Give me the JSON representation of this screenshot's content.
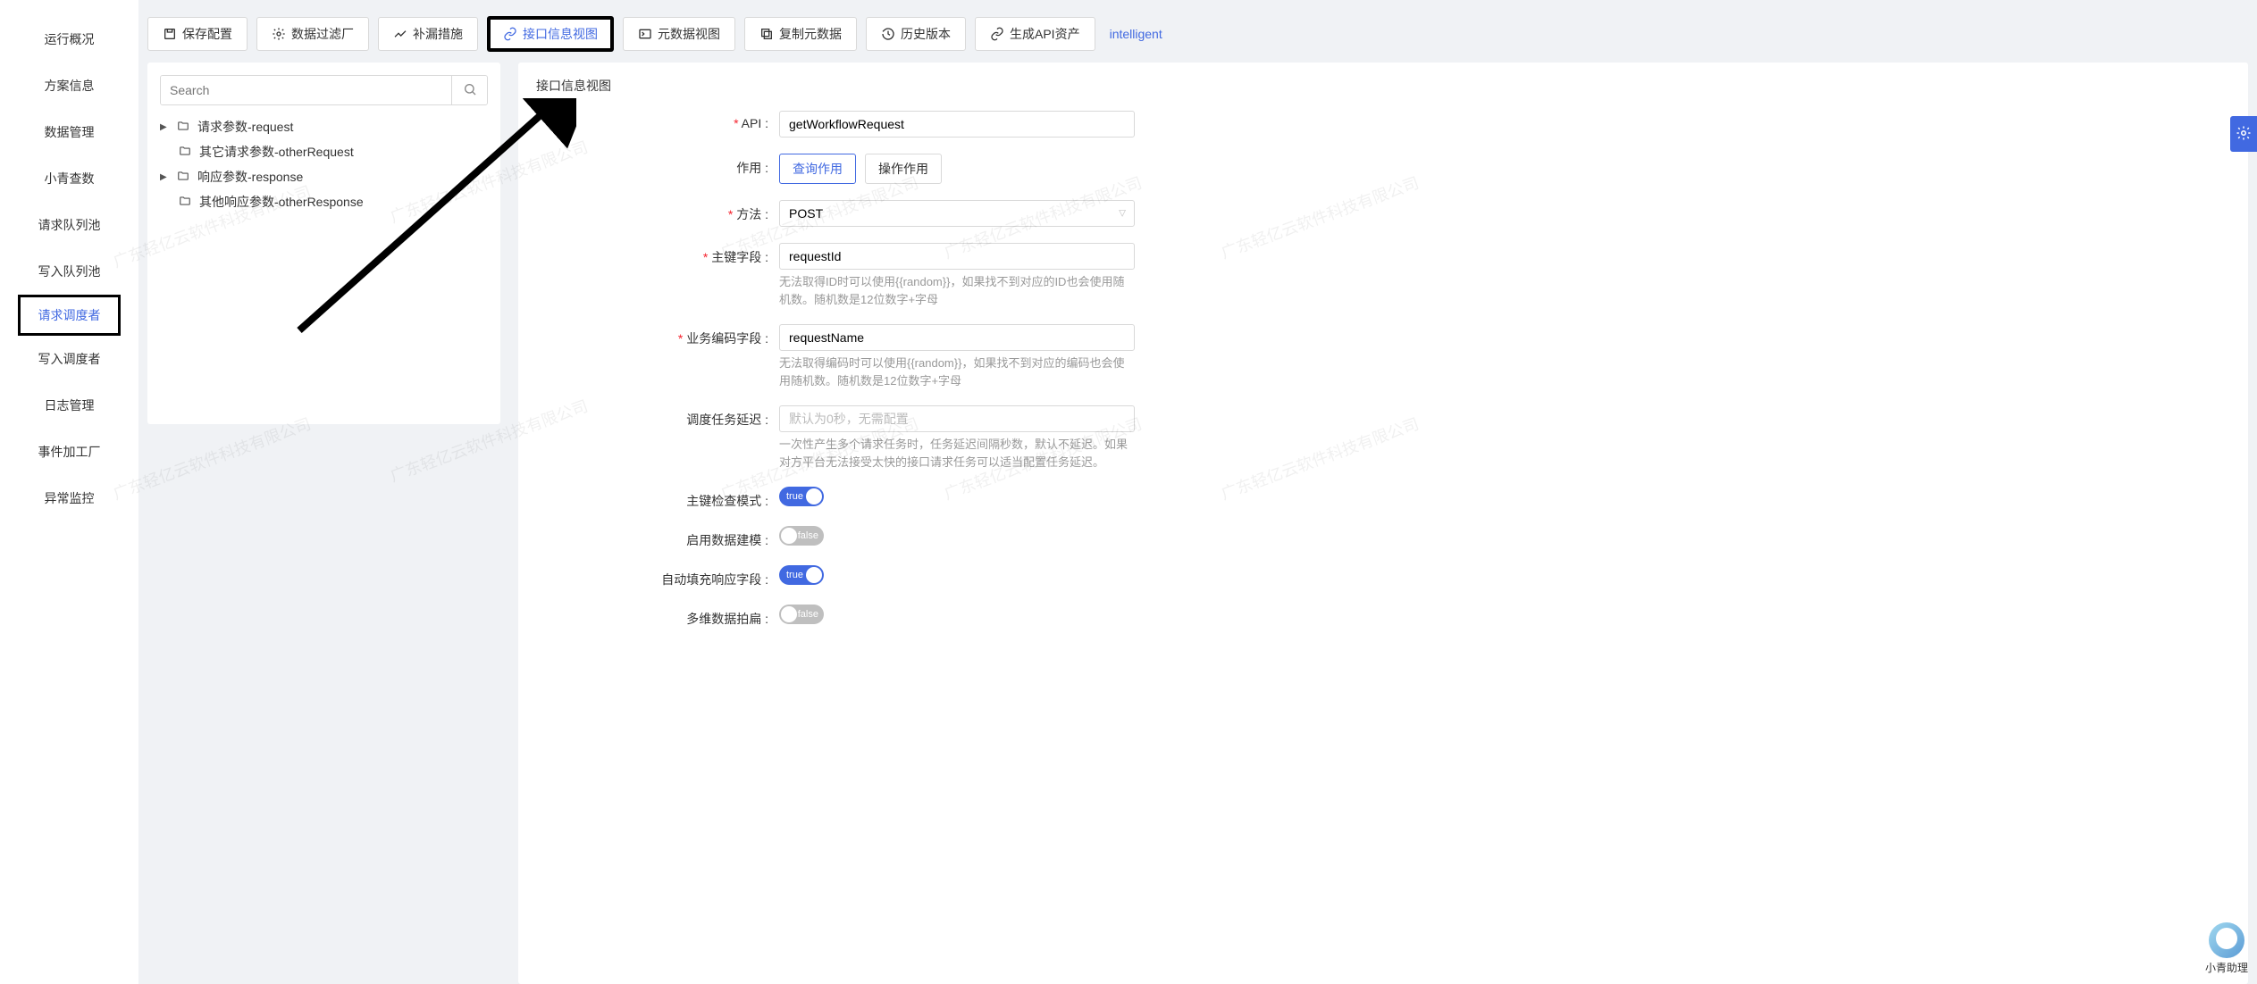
{
  "sidebar": {
    "items": [
      {
        "label": "运行概况"
      },
      {
        "label": "方案信息"
      },
      {
        "label": "数据管理"
      },
      {
        "label": "小青查数"
      },
      {
        "label": "请求队列池"
      },
      {
        "label": "写入队列池"
      },
      {
        "label": "请求调度者"
      },
      {
        "label": "写入调度者"
      },
      {
        "label": "日志管理"
      },
      {
        "label": "事件加工厂"
      },
      {
        "label": "异常监控"
      }
    ],
    "active_index": 6
  },
  "toolbar": {
    "save": "保存配置",
    "filter": "数据过滤厂",
    "patch": "补漏措施",
    "api_view": "接口信息视图",
    "metadata": "元数据视图",
    "copy_meta": "复制元数据",
    "history": "历史版本",
    "gen_api": "生成API资产",
    "intelligent": "intelligent"
  },
  "tree": {
    "search_placeholder": "Search",
    "items": [
      {
        "label": "请求参数-request",
        "expand": true
      },
      {
        "label": "其它请求参数-otherRequest",
        "expand": false
      },
      {
        "label": "响应参数-response",
        "expand": true
      },
      {
        "label": "其他响应参数-otherResponse",
        "expand": false
      }
    ]
  },
  "panel": {
    "title": "接口信息视图",
    "api_label": "API :",
    "api_value": "getWorkflowRequest",
    "role_label": "作用 :",
    "role_options": [
      "查询作用",
      "操作作用"
    ],
    "role_selected": 0,
    "method_label": "方法 :",
    "method_value": "POST",
    "pk_label": "主键字段 :",
    "pk_value": "requestId",
    "pk_help": "无法取得ID时可以使用{{random}}，如果找不到对应的ID也会使用随机数。随机数是12位数字+字母",
    "biz_label": "业务编码字段 :",
    "biz_value": "requestName",
    "biz_help": "无法取得编码时可以使用{{random}}，如果找不到对应的编码也会使用随机数。随机数是12位数字+字母",
    "delay_label": "调度任务延迟 :",
    "delay_placeholder": "默认为0秒，无需配置",
    "delay_help": "一次性产生多个请求任务时，任务延迟间隔秒数，默认不延迟。如果对方平台无法接受太快的接口请求任务可以适当配置任务延迟。",
    "pk_check_label": "主键检查模式 :",
    "pk_check_on": true,
    "model_label": "启用数据建模 :",
    "model_on": false,
    "autofill_label": "自动填充响应字段 :",
    "autofill_on": true,
    "flatten_label": "多维数据拍扁 :",
    "flatten_on": false,
    "true_text": "true",
    "false_text": "false"
  },
  "assistant": {
    "label": "小青助理"
  },
  "watermark": "广东轻亿云软件科技有限公司"
}
